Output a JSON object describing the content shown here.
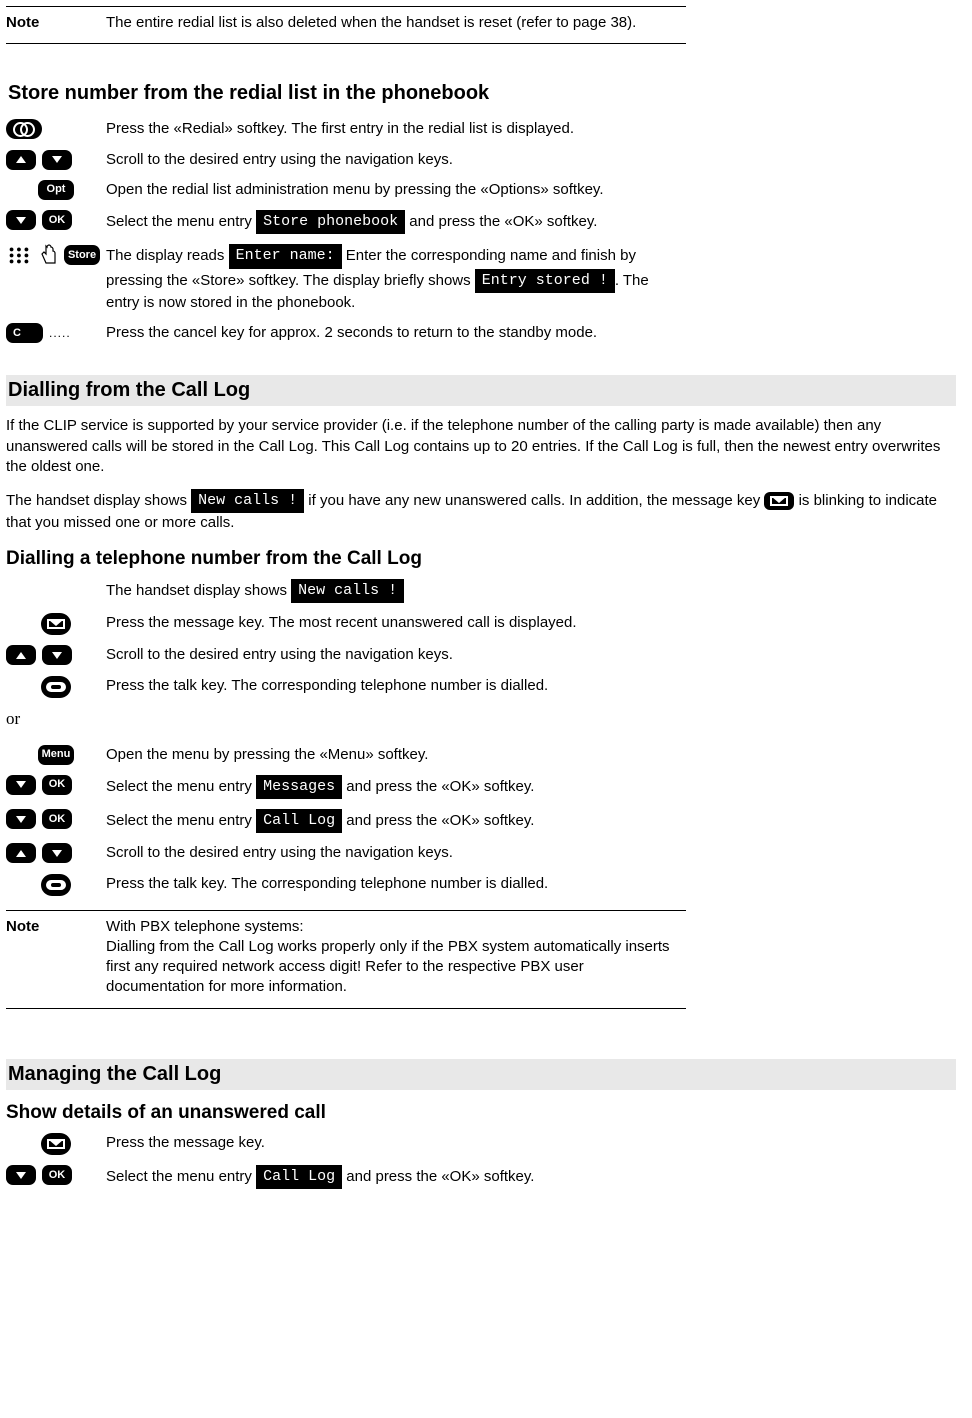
{
  "note_top": {
    "label": "Note",
    "text": "The entire redial list is also deleted when the handset is reset (refer to page 38)."
  },
  "store_section": {
    "heading": "Store number from the redial list in the phonebook",
    "steps": {
      "s1": "Press the «Redial» softkey. The first entry in the redial list is displayed.",
      "s2": "Scroll to the desired entry using the navigation keys.",
      "s3": "Open the redial list administration menu by pressing the «Options» softkey.",
      "s4_pre": "Select the menu entry ",
      "s4_lcd": " Store phonebook ",
      "s4_post": " and press the «OK» softkey.",
      "s5_pre": "The display reads ",
      "s5_lcd1": " Enter name: ",
      "s5_mid1": " Enter the corresponding  name and finish by pressing the «Store» softkey. The display briefly shows ",
      "s5_lcd2": " Entry stored ! ",
      "s5_end": ". The entry is now stored in the phonebook.",
      "s6": "Press the cancel key for approx. 2 seconds to return to the standby mode."
    },
    "labels": {
      "opt": "Opt",
      "ok": "OK",
      "store": "Store",
      "c": "C"
    }
  },
  "dial_section": {
    "heading": "Dialling from the Call Log",
    "intro": "If the CLIP service is supported by your service provider (i.e. if the telephone number of the calling party is made available) then any unanswered calls will be stored in the Call Log. This Call Log contains up to 20 entries. If the Call Log is full, then the newest entry overwrites the oldest one.",
    "p2_pre": "The handset display shows ",
    "p2_lcd": " New calls ! ",
    "p2_mid": " if you have any new unanswered calls. In addition, the message key ",
    "p2_end": " is blinking to indicate that you missed one or more calls.",
    "sub_heading": "Dialling a telephone number from the Call Log",
    "steps": {
      "s0_pre": "The handset display shows ",
      "s0_lcd": " New calls ! ",
      "s1": "Press the message key. The most recent unanswered call is displayed.",
      "s2": "Scroll to the desired entry using the navigation keys.",
      "s3": "Press the talk key. The corresponding telephone number is dialled.",
      "or": "or",
      "s4": "Open the menu by pressing the «Menu» softkey.",
      "s5_pre": "Select the menu entry ",
      "s5_lcd": " Messages ",
      "s5_post": " and press the «OK» softkey.",
      "s6_pre": "Select the menu entry ",
      "s6_lcd": " Call Log ",
      "s6_post": " and press the «OK» softkey.",
      "s7": "Scroll to the desired entry using the navigation keys.",
      "s8": "Press the talk key. The corresponding telephone number is dialled."
    },
    "labels": {
      "menu": "Menu",
      "ok": "OK"
    },
    "note": {
      "label": "Note",
      "line1": "With PBX telephone systems:",
      "line2": "Dialling from the Call Log works properly only if the PBX system automatically inserts first any required network access digit! Refer to the respective PBX user documentation for more information."
    }
  },
  "manage_section": {
    "heading": "Managing the Call Log",
    "sub_heading": "Show details of an unanswered call",
    "steps": {
      "s1": "Press the message key.",
      "s2_pre": "Select the menu entry ",
      "s2_lcd": " Call Log ",
      "s2_post": " and press the «OK» softkey."
    },
    "labels": {
      "ok": "OK"
    }
  }
}
